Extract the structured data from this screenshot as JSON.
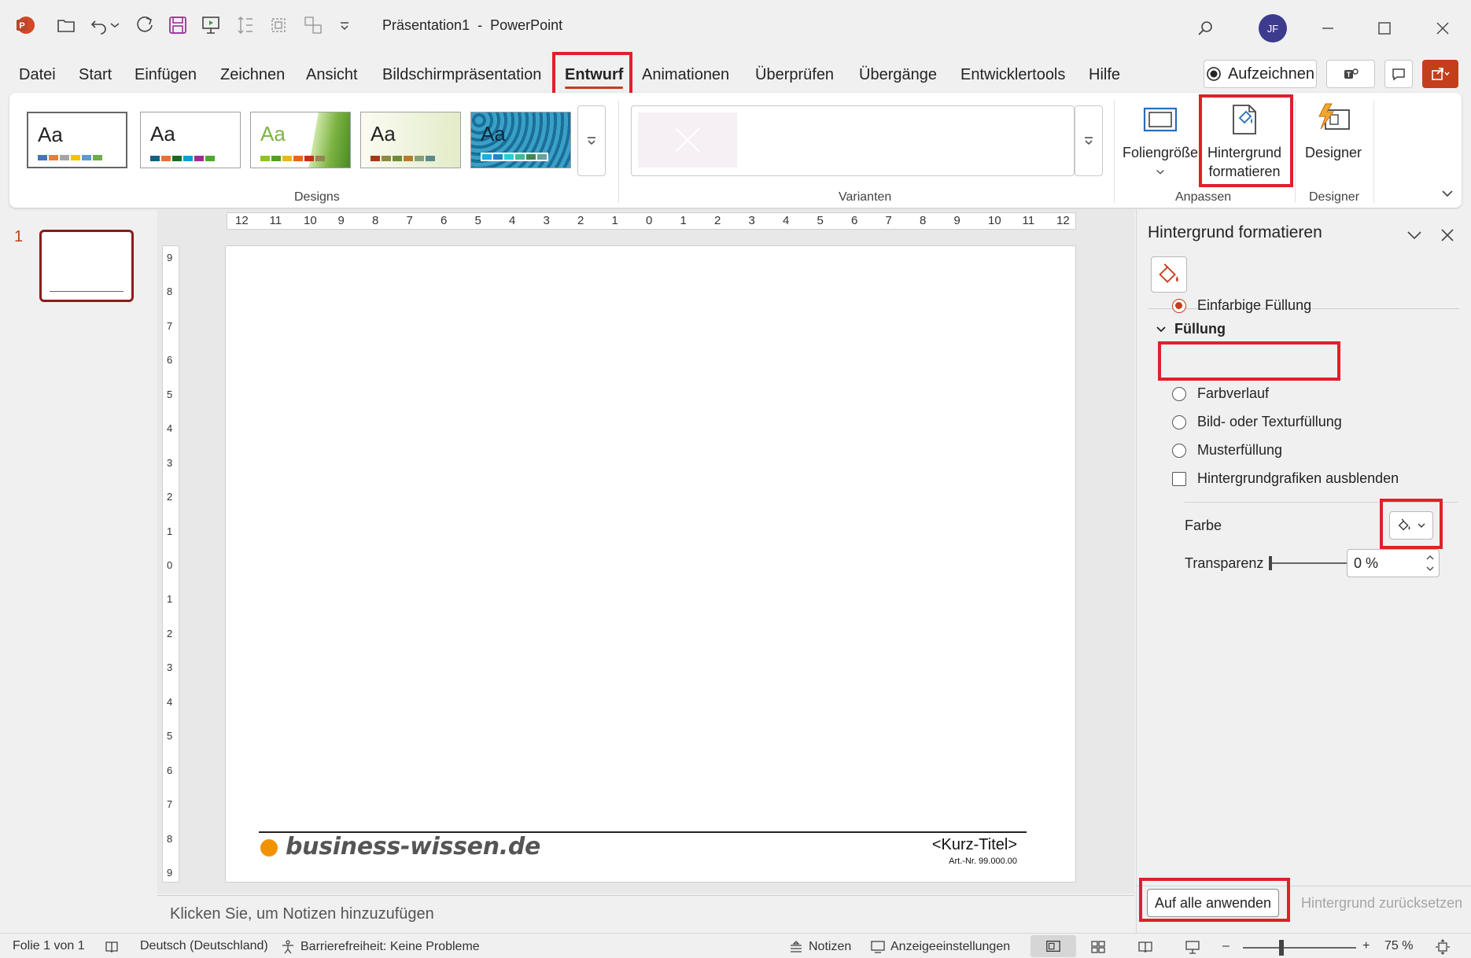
{
  "titlebar": {
    "doc_name": "Präsentation1",
    "separator": "-",
    "app_name": "PowerPoint",
    "user_initials": "JF"
  },
  "menu": {
    "tabs": [
      "Datei",
      "Start",
      "Einfügen",
      "Zeichnen",
      "Ansicht",
      "Bildschirmpräsentation",
      "Entwurf",
      "Animationen",
      "Überprüfen",
      "Übergänge",
      "Entwicklertools",
      "Hilfe"
    ],
    "active_tab": "Entwurf",
    "record_label": "Aufzeichnen"
  },
  "ribbon": {
    "designs_label": "Designs",
    "theme_sample": "Aa",
    "variants_label": "Varianten",
    "slide_size_label": "Foliengröße",
    "format_bg_line1": "Hintergrund",
    "format_bg_line2": "formatieren",
    "customize_label": "Anpassen",
    "designer_btn_label": "Designer",
    "designer_group_label": "Designer"
  },
  "slides": {
    "number": "1"
  },
  "rulers": {
    "horizontal": [
      "12",
      "11",
      "10",
      "9",
      "8",
      "7",
      "6",
      "5",
      "4",
      "3",
      "2",
      "1",
      "0",
      "1",
      "2",
      "3",
      "4",
      "5",
      "6",
      "7",
      "8",
      "9",
      "10",
      "11",
      "12"
    ],
    "vertical": [
      "9",
      "8",
      "7",
      "6",
      "5",
      "4",
      "3",
      "2",
      "1",
      "0",
      "1",
      "2",
      "3",
      "4",
      "5",
      "6",
      "7",
      "8",
      "9"
    ]
  },
  "slide": {
    "brand": "business-wissen.de",
    "short_title": "<Kurz-Titel>",
    "article_no": "Art.-Nr. 99.000.00"
  },
  "notes": {
    "placeholder": "Klicken Sie, um Notizen hinzuzufügen"
  },
  "pane": {
    "title": "Hintergrund formatieren",
    "section": "Füllung",
    "options": {
      "solid": "Einfarbige Füllung",
      "gradient": "Farbverlauf",
      "picture": "Bild- oder Texturfüllung",
      "pattern": "Musterfüllung"
    },
    "hide_graphics": "Hintergrundgrafiken ausblenden",
    "color_label": "Farbe",
    "transparency_label": "Transparenz",
    "transparency_value": "0 %",
    "transparency_fraction": 0,
    "apply_all": "Auf alle anwenden",
    "reset": "Hintergrund zurücksetzen"
  },
  "status": {
    "slide_info": "Folie 1 von 1",
    "language": "Deutsch (Deutschland)",
    "accessibility": "Barrierefreiheit: Keine Probleme",
    "notes": "Notizen",
    "display_settings": "Anzeigeeinstellungen",
    "zoom": "75 %",
    "zoom_minus": "–",
    "zoom_plus": "+"
  },
  "colors": {
    "accent": "#c43e1c",
    "highlight_box": "#e0202a",
    "brand_dot": "#f39200",
    "avatar": "#3d3b8e"
  },
  "icons": [
    "powerpoint-logo-icon",
    "open-folder-icon",
    "undo-icon",
    "redo-icon",
    "save-icon",
    "present-icon",
    "search-icon",
    "minimize-icon",
    "maximize-icon",
    "close-icon",
    "record-dot-icon",
    "share-icon",
    "comment-icon",
    "teams-icon",
    "paint-bucket-icon"
  ]
}
